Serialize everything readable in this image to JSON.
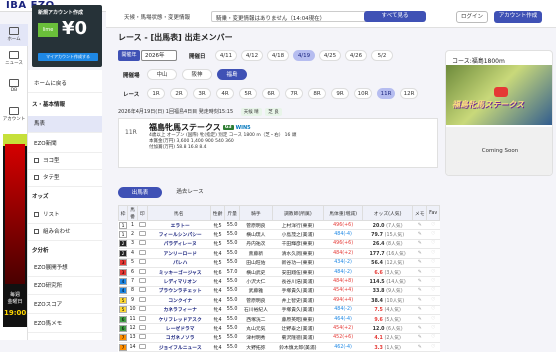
{
  "brand": {
    "logo": "IBA EZO"
  },
  "topbar": {
    "notice_label": "天候・馬場状態・変更情報",
    "notice_text": "騎乗・変更情報はありません（14:04現在）",
    "show_all": "すべて見る",
    "login": "ログイン",
    "create_account": "アカウント作成"
  },
  "ad": {
    "line1": "新規アカウント作成",
    "amount": "¥0",
    "tag": "lime",
    "cta": "マイアカウント作成する"
  },
  "iconbar": [
    {
      "label": "ホーム",
      "icon": "home-icon"
    },
    {
      "label": "ニュース",
      "icon": "news-icon"
    },
    {
      "label": "DB",
      "icon": "db-icon"
    },
    {
      "label": "アカウント",
      "icon": "account-icon"
    }
  ],
  "tall_ad": {
    "text": "毎週",
    "sub": "金曜日",
    "time": "19:00"
  },
  "sidenav": {
    "back": "ホームに戻る",
    "section1": "ス・基本情報",
    "items1": [
      "馬表"
    ],
    "items_mid": [
      "EZO新聞",
      "ヨコ型",
      "タテ型"
    ],
    "section_odds": "オッズ",
    "items_odds": [
      "リスト",
      "組み合わせ"
    ],
    "section2": "夕分析",
    "items2": [
      "EZO展開予想",
      "EZO研究所",
      "EZOスコア",
      "EZO馬メモ"
    ]
  },
  "main": {
    "title": "レース - [出馬表] 出走メンバー",
    "year_label": "開催年",
    "year_value": "2026年",
    "date_label": "開催日",
    "dates": [
      "4/11",
      "4/12",
      "4/18",
      "4/19",
      "4/25",
      "4/26",
      "5/2"
    ],
    "venue_label": "開催場",
    "venues": [
      "中山",
      "阪神",
      "福島"
    ],
    "race_label": "レース",
    "races": [
      "1R",
      "2R",
      "3R",
      "4R",
      "5R",
      "6R",
      "7R",
      "8R",
      "9R",
      "10R",
      "11R",
      "12R"
    ],
    "info_line": "2026年4月19日(日) 1回福島4日目 発走時刻15:15",
    "weather_label": "天候",
    "weather": "晴",
    "turf_label": "芝",
    "turf": "良",
    "race": {
      "num": "11R",
      "name": "福島牝馬ステークス",
      "grade": "G3",
      "win": "WIN5",
      "meta1": "4歳以上 オープン (国際) 牝(指定) 別定 コース 1800 m（芝・右） 16 頭",
      "meta2": "本賞金(万円) 3,600 1,400 900 540 360",
      "meta3": "付加賞(万円) 58.8 16.8 8.4"
    },
    "subtabs": [
      "出馬表",
      "過去レース"
    ]
  },
  "table": {
    "headers": [
      "枠",
      "馬番",
      "印",
      "馬名",
      "性齢",
      "斤量",
      "騎手",
      "調教師(所属)",
      "馬体重(増減)",
      "オッズ(人気)",
      "メモ",
      "Fav"
    ],
    "rows": [
      {
        "waku": "1",
        "num": "1",
        "name": "エラトー",
        "sex": "牝5",
        "kin": "55.0",
        "jockey": "菅原明良",
        "trainer": "上村洋行(栗東)",
        "weight": "496(+6)",
        "odds": "20.0",
        "pop": "(7人気)"
      },
      {
        "waku": "1",
        "num": "2",
        "name": "フィールシンパシー",
        "sex": "牝5",
        "kin": "55.0",
        "jockey": "横山琉人",
        "trainer": "小島茂之(美浦)",
        "weight": "484(-4)",
        "odds": "79.7",
        "pop": "(15人気)"
      },
      {
        "waku": "2",
        "num": "3",
        "name": "パラディレーヌ",
        "sex": "牝5",
        "kin": "55.0",
        "jockey": "丹内祐次",
        "trainer": "千田輝彦(栗東)",
        "weight": "496(+6)",
        "odds": "26.4",
        "pop": "(8人気)"
      },
      {
        "waku": "2",
        "num": "4",
        "name": "アンリーロード",
        "sex": "牝4",
        "kin": "55.0",
        "jockey": "斎藤新",
        "trainer": "清水久詞(栗東)",
        "weight": "484(+2)",
        "odds": "177.7",
        "pop": "(16人気)"
      },
      {
        "waku": "3",
        "num": "5",
        "name": "パレハ",
        "sex": "牝5",
        "kin": "55.0",
        "jockey": "田山旺佑",
        "trainer": "新谷功一(栗東)",
        "weight": "434(-2)",
        "odds": "56.4",
        "pop": "(12人気)"
      },
      {
        "waku": "3",
        "num": "6",
        "name": "ミッキーゴージャス",
        "sex": "牝6",
        "kin": "57.0",
        "jockey": "横山武史",
        "trainer": "安田翔伍(栗東)",
        "weight": "484(-2)",
        "odds": "6.6",
        "pop": "(3人気)"
      },
      {
        "waku": "4",
        "num": "7",
        "name": "レディマリオン",
        "sex": "牝4",
        "kin": "55.0",
        "jockey": "小沢大仁",
        "trainer": "長谷川浩(美浦)",
        "weight": "484(+8)",
        "odds": "114.5",
        "pop": "(14人気)"
      },
      {
        "waku": "4",
        "num": "8",
        "name": "ブラウンラチェット",
        "sex": "牝4",
        "kin": "55.0",
        "jockey": "武藤雅",
        "trainer": "手塚貴久(美浦)",
        "weight": "454(+4)",
        "odds": "33.8",
        "pop": "(9人気)"
      },
      {
        "waku": "5",
        "num": "9",
        "name": "コンクイナ",
        "sex": "牝4",
        "kin": "55.0",
        "jockey": "菅原明良",
        "trainer": "井上智史(美浦)",
        "weight": "494(+4)",
        "odds": "38.4",
        "pop": "(10人気)"
      },
      {
        "waku": "5",
        "num": "10",
        "name": "カネラフィーナ",
        "sex": "牝4",
        "kin": "55.0",
        "jockey": "石川裕紀人",
        "trainer": "手塚貴久(美浦)",
        "weight": "484(-2)",
        "odds": "7.5",
        "pop": "(4人気)"
      },
      {
        "waku": "6",
        "num": "11",
        "name": "ケリフレッドアスク",
        "sex": "牝4",
        "kin": "55.0",
        "jockey": "西塚洸二",
        "trainer": "藤原英昭(栗東)",
        "weight": "464(-4)",
        "odds": "9.6",
        "pop": "(5人気)"
      },
      {
        "waku": "6",
        "num": "12",
        "name": "レーゼドラマ",
        "sex": "牝4",
        "kin": "55.0",
        "jockey": "丸山元気",
        "trainer": "辻野泰之(美浦)",
        "weight": "454(+2)",
        "odds": "12.0",
        "pop": "(6人気)"
      },
      {
        "waku": "7",
        "num": "13",
        "name": "コガネノソラ",
        "sex": "牝5",
        "kin": "55.0",
        "jockey": "津村明秀",
        "trainer": "菊沢隆徳(美浦)",
        "weight": "452(+6)",
        "odds": "4.1",
        "pop": "(2人気)"
      },
      {
        "waku": "7",
        "num": "14",
        "name": "ジョイフルニュース",
        "sex": "牝4",
        "kin": "55.0",
        "jockey": "大野拓弥",
        "trainer": "鈴木慎太郎(美浦)",
        "weight": "462(-4)",
        "odds": "3.3",
        "pop": "(1人気)"
      }
    ]
  },
  "rpanel": {
    "course": "コース:福島1800m",
    "video_title": "福島牝馬ステークス",
    "coming_soon": "Coming Soon"
  },
  "colors": {
    "accent": "#3f51b5",
    "waku": [
      "#ffffff",
      "#222222",
      "#e53935",
      "#1e88e5",
      "#fdd835",
      "#43a047",
      "#fb8c00",
      "#f48fb1"
    ]
  }
}
